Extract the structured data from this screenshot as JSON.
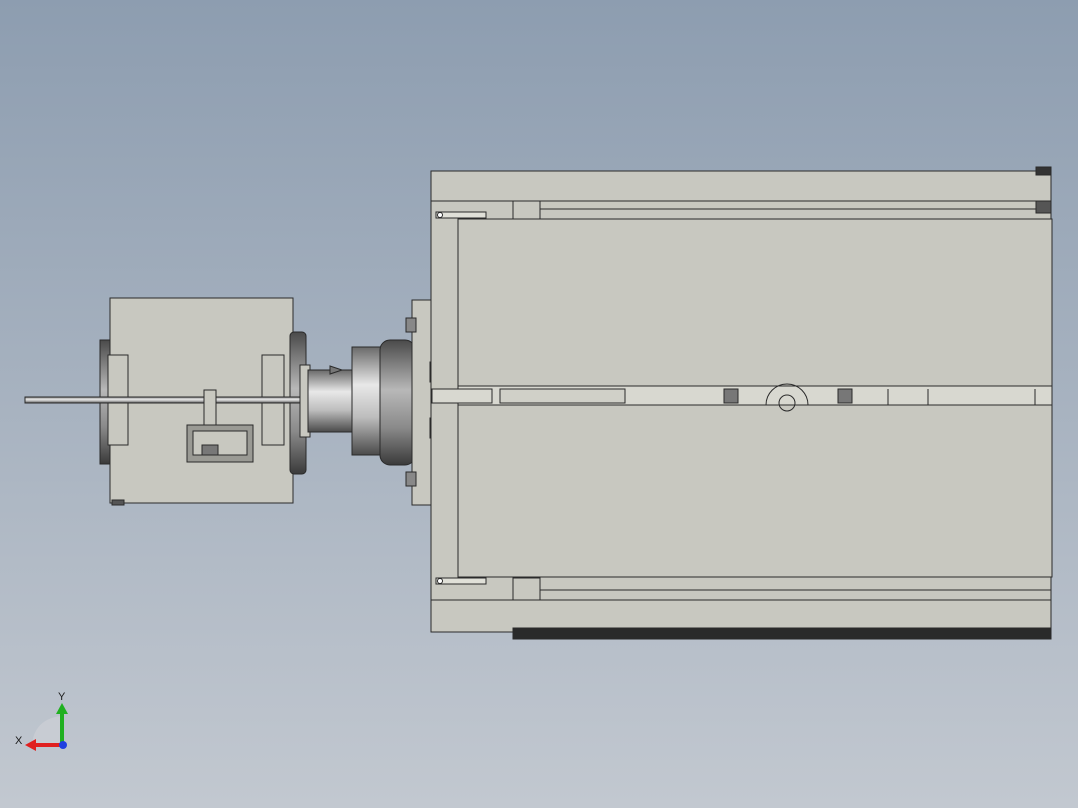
{
  "viewport": {
    "background_top": "#8d9db0",
    "background_bottom": "#c2c8d0"
  },
  "model": {
    "part_face_color": "#c8c8c0",
    "part_edge_color": "#2a2a2a",
    "motor_color_light": "#e6e6e6",
    "motor_color_dark": "#5a5a5a"
  },
  "triad": {
    "x_label": "X",
    "y_label": "Y",
    "x_color": "#e02020",
    "y_color": "#20b020",
    "z_color": "#2040e0"
  }
}
